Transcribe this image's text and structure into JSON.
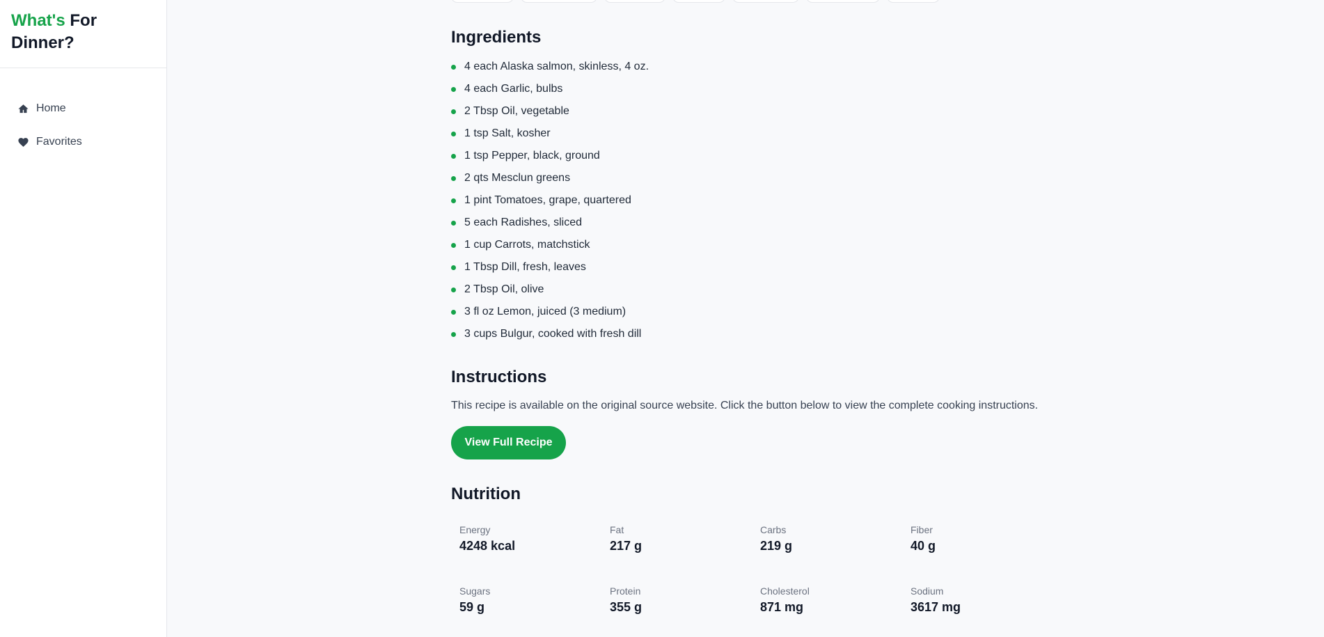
{
  "app": {
    "title_accent": "What's",
    "title_rest": " For Dinner?"
  },
  "sidebar": {
    "items": [
      {
        "label": "Home",
        "icon": "home-icon"
      },
      {
        "label": "Favorites",
        "icon": "heart-icon"
      }
    ]
  },
  "ingredients": {
    "title": "Ingredients",
    "items": [
      "4 each Alaska salmon, skinless, 4 oz.",
      "4 each Garlic, bulbs",
      "2 Tbsp Oil, vegetable",
      "1 tsp Salt, kosher",
      "1 tsp Pepper, black, ground",
      "2 qts Mesclun greens",
      "1 pint Tomatoes, grape, quartered",
      "5 each Radishes, sliced",
      "1 cup Carrots, matchstick",
      "1 Tbsp Dill, fresh, leaves",
      "2 Tbsp Oil, olive",
      "3 fl oz Lemon, juiced (3 medium)",
      "3 cups Bulgur, cooked with fresh dill"
    ]
  },
  "instructions": {
    "title": "Instructions",
    "text": "This recipe is available on the original source website. Click the button below to view the complete cooking instructions.",
    "button_label": "View Full Recipe"
  },
  "nutrition": {
    "title": "Nutrition",
    "items": [
      {
        "label": "Energy",
        "value": "4248 kcal"
      },
      {
        "label": "Fat",
        "value": "217 g"
      },
      {
        "label": "Carbs",
        "value": "219 g"
      },
      {
        "label": "Fiber",
        "value": "40 g"
      },
      {
        "label": "Sugars",
        "value": "59 g"
      },
      {
        "label": "Protein",
        "value": "355 g"
      },
      {
        "label": "Cholesterol",
        "value": "871 mg"
      },
      {
        "label": "Sodium",
        "value": "3617 mg"
      }
    ]
  },
  "colors": {
    "accent": "#16a34a",
    "background": "#f8f9fb",
    "text": "#111827"
  }
}
